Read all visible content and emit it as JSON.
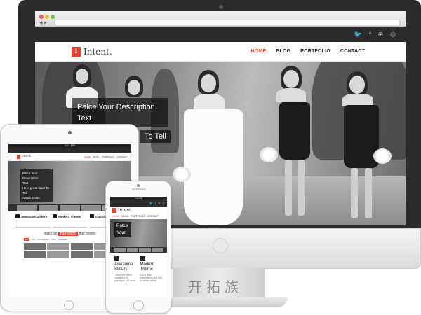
{
  "desktop": {
    "social_icons": [
      "twitter-icon",
      "facebook-icon",
      "dribbble-icon",
      "rss-icon"
    ],
    "social_glyphs": [
      "🐦",
      "f",
      "⊕",
      "◎"
    ],
    "logo_letter": "i",
    "logo_text": "Intent.",
    "nav": [
      "HOME",
      "BLOG",
      "PORTFOLIO",
      "CONTACT"
    ],
    "active_nav": "HOME",
    "hero_caption_line1": "Palce Your Description",
    "hero_caption_line2": "Text",
    "hero_caption_partial": "To Tell"
  },
  "watermark": "开拓族",
  "tablet": {
    "status": "4:21 PM",
    "logo_text": "Intent.",
    "nav": [
      "HOME",
      "BLOG",
      "PORTFOLIO",
      "CONTACT"
    ],
    "caption": [
      "Palce Your Description",
      "Text",
      "Here great Spot To Tell",
      "About Shots."
    ],
    "features": [
      "Awesome Sliders",
      "Modern Theme",
      "Customize"
    ],
    "impression_before": "make an",
    "impression_highlight": "impression",
    "impression_after": "that shines",
    "filters": [
      "All",
      "Print",
      "Photography",
      "Web",
      "Illustration"
    ]
  },
  "phone": {
    "status": "4:21 PM",
    "logo_text": "Intent.",
    "nav": [
      "HOME",
      "BLOG",
      "PORTFOLIO",
      "CONTACT"
    ],
    "caption": [
      "Palce",
      "Your"
    ],
    "features": [
      {
        "title": "Awesome Sliders",
        "desc": "There are many variations of passages of Lorem"
      },
      {
        "title": "Modern Theme",
        "desc": "It is a long established fact that a reader will be"
      }
    ]
  },
  "colors": {
    "accent": "#e2412d",
    "dark_bar": "#2b2b2b"
  }
}
